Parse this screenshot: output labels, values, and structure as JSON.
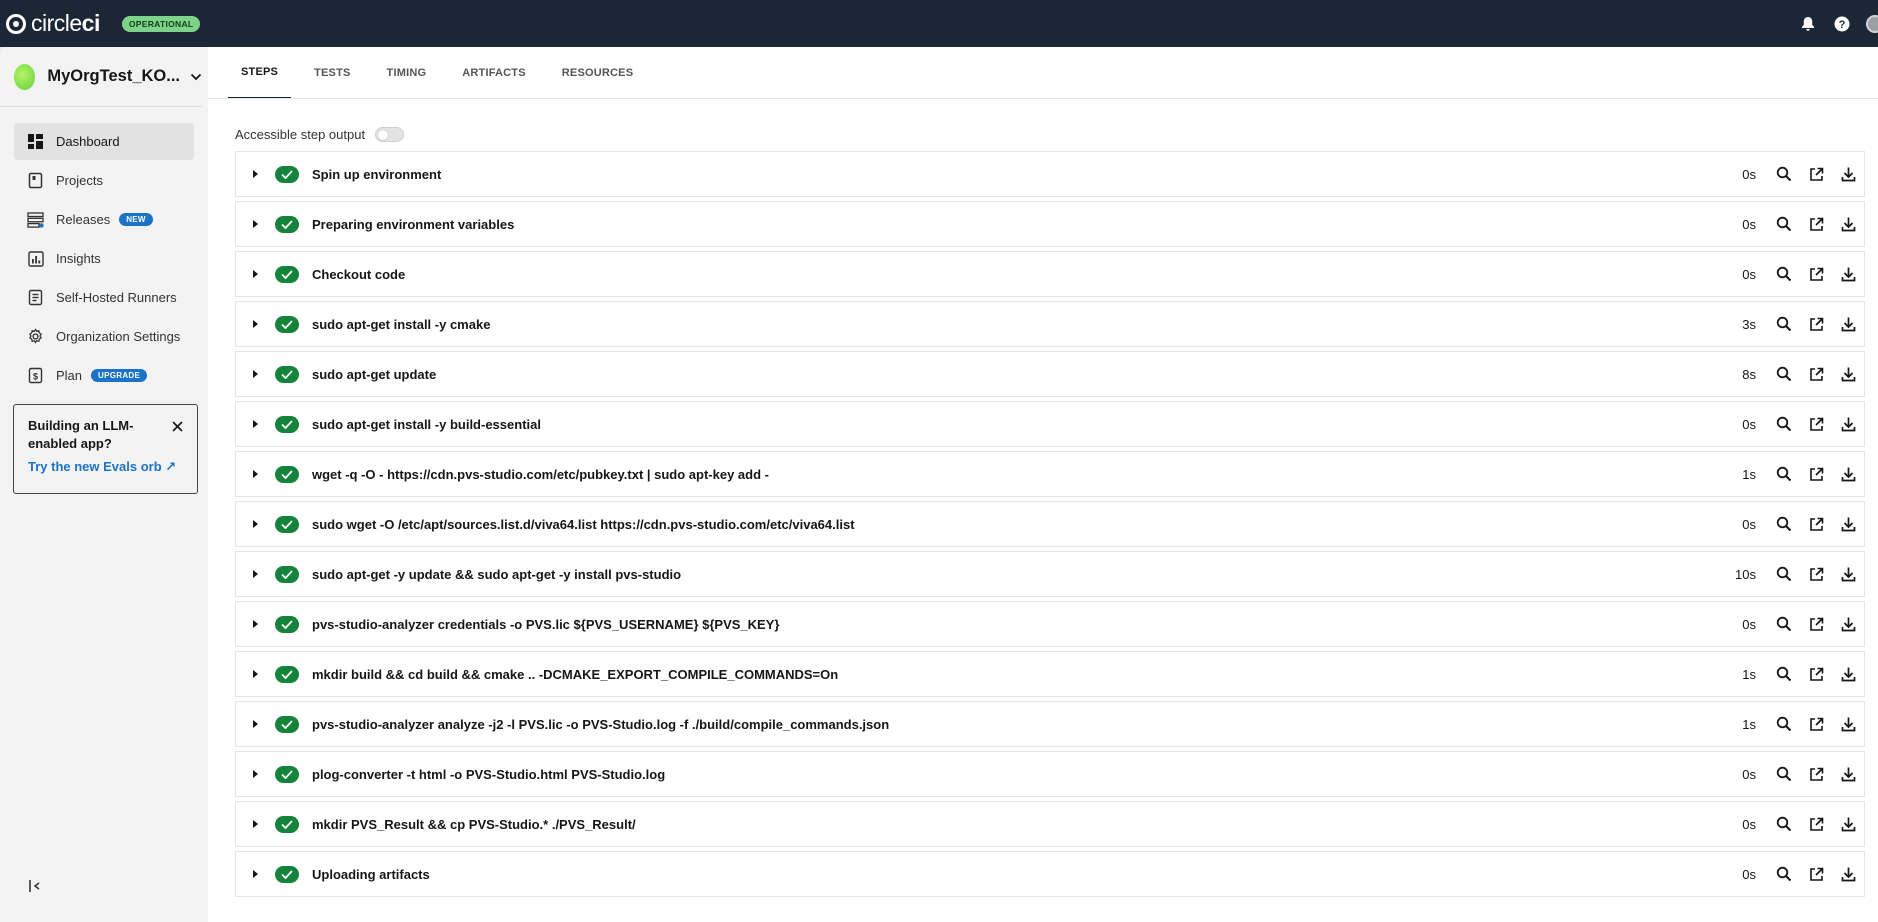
{
  "topbar": {
    "logo_text_light": "circle",
    "logo_text_bold": "ci",
    "status_badge": "OPERATIONAL",
    "icons": [
      "bell-icon",
      "help-icon",
      "user-avatar"
    ]
  },
  "sidebar": {
    "org_name": "MyOrgTest_KO...",
    "items": [
      {
        "label": "Dashboard",
        "icon": "dashboard-icon",
        "active": true
      },
      {
        "label": "Projects",
        "icon": "projects-icon"
      },
      {
        "label": "Releases",
        "icon": "releases-icon",
        "badge": "NEW"
      },
      {
        "label": "Insights",
        "icon": "insights-icon"
      },
      {
        "label": "Self-Hosted Runners",
        "icon": "runners-icon"
      },
      {
        "label": "Organization Settings",
        "icon": "gear-icon"
      },
      {
        "label": "Plan",
        "icon": "plan-icon",
        "badge": "UPGRADE"
      }
    ],
    "promo": {
      "title": "Building an LLM-enabled app?",
      "link": "Try the new Evals orb ↗"
    }
  },
  "tabs": [
    "STEPS",
    "TESTS",
    "TIMING",
    "ARTIFACTS",
    "RESOURCES"
  ],
  "active_tab": "STEPS",
  "toggle_label": "Accessible step output",
  "steps": [
    {
      "name": "Spin up environment",
      "duration": "0s"
    },
    {
      "name": "Preparing environment variables",
      "duration": "0s"
    },
    {
      "name": "Checkout code",
      "duration": "0s"
    },
    {
      "name": "sudo apt-get install -y cmake",
      "duration": "3s"
    },
    {
      "name": "sudo apt-get update",
      "duration": "8s"
    },
    {
      "name": "sudo apt-get install -y build-essential",
      "duration": "0s"
    },
    {
      "name": "wget -q -O - https://cdn.pvs-studio.com/etc/pubkey.txt | sudo apt-key add -",
      "duration": "1s"
    },
    {
      "name": "sudo wget -O /etc/apt/sources.list.d/viva64.list https://cdn.pvs-studio.com/etc/viva64.list",
      "duration": "0s"
    },
    {
      "name": "sudo apt-get -y update && sudo apt-get -y install pvs-studio",
      "duration": "10s"
    },
    {
      "name": "pvs-studio-analyzer credentials -o PVS.lic ${PVS_USERNAME} ${PVS_KEY}",
      "duration": "0s"
    },
    {
      "name": "mkdir build && cd build && cmake .. -DCMAKE_EXPORT_COMPILE_COMMANDS=On",
      "duration": "1s"
    },
    {
      "name": "pvs-studio-analyzer analyze -j2 -l PVS.lic -o PVS-Studio.log -f ./build/compile_commands.json",
      "duration": "1s"
    },
    {
      "name": "plog-converter -t html -o PVS-Studio.html PVS-Studio.log",
      "duration": "0s"
    },
    {
      "name": "mkdir PVS_Result && cp PVS-Studio.* ./PVS_Result/",
      "duration": "0s"
    },
    {
      "name": "Uploading artifacts",
      "duration": "0s"
    }
  ],
  "colors": {
    "topbar": "#1c2736",
    "success": "#14843a",
    "badge_blue": "#1b73c9",
    "operational": "#7ed38b"
  }
}
